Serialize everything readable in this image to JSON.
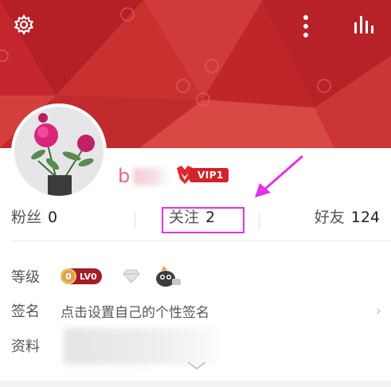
{
  "header": {
    "settings_icon": "gear-icon",
    "more_icon": "vertical-dots-icon",
    "stats_icon": "bar-chart-icon",
    "accent": "#c0272d"
  },
  "profile": {
    "username_visible": "b",
    "vip_label": "VIP1"
  },
  "stats": {
    "fans_label": "粉丝",
    "fans_value": "0",
    "follow_label": "关注",
    "follow_value": "2",
    "friends_label": "好友",
    "friends_value": "124"
  },
  "details": {
    "level_label": "等级",
    "level_badge": "LV0",
    "level_coin": "0",
    "sign_label": "签名",
    "sign_placeholder": "点击设置自己的个性签名",
    "info_label": "资料"
  },
  "colors": {
    "highlight_border": "#e233e4",
    "arrow": "#e233e4",
    "vip_red": "#d2222c"
  }
}
